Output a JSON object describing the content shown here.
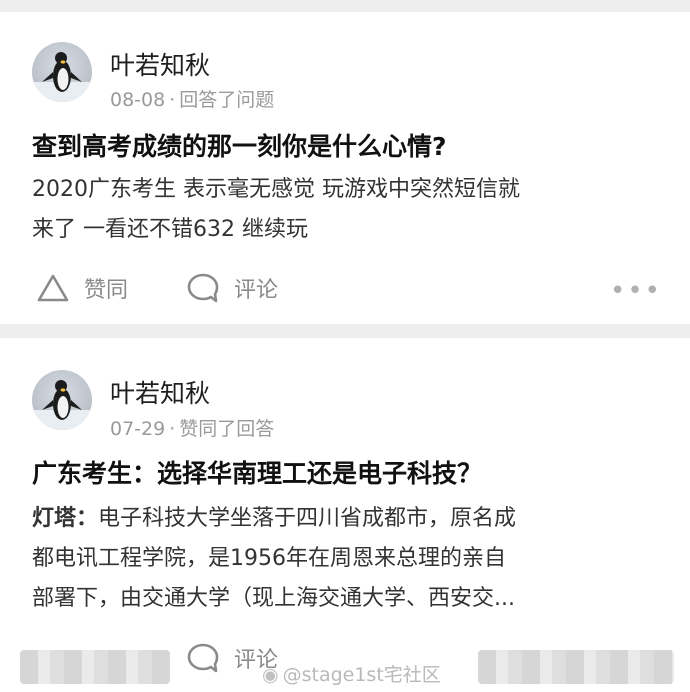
{
  "posts": [
    {
      "author": "叶若知秋",
      "date": "08-08",
      "action": "回答了问题",
      "title": "查到高考成绩的那一刻你是什么心情?",
      "body_lines": [
        "2020广东考生 表示毫无感觉 玩游戏中突然短信就",
        "来了 一看还不错632 继续玩"
      ],
      "actions": {
        "like": "赞同",
        "comment": "评论",
        "more": "•••"
      }
    },
    {
      "author": "叶若知秋",
      "date": "07-29",
      "action": "赞同了回答",
      "title": "广东考生：选择华南理工还是电子科技？",
      "body_lead": "灯塔：",
      "body_lines": [
        "电子科技大学坐落于四川省成都市，原名成",
        "都电讯工程学院，是1956年在周恩来总理的亲自",
        "部署下，由交通大学（现上海交通大学、西安交..."
      ],
      "actions": {
        "comment": "评论"
      }
    }
  ],
  "watermark": "@stage1st宅社区",
  "icons": [
    "penguin-avatar-icon",
    "like-triangle-icon",
    "comment-bubble-icon",
    "more-dots-icon",
    "weibo-icon"
  ]
}
